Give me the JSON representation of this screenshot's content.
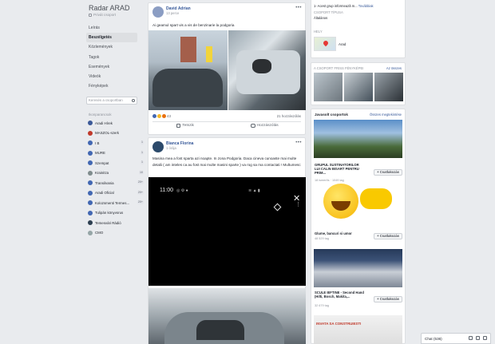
{
  "sidebar": {
    "group_title": "Radar ARAD",
    "group_privacy": "Privát csoport",
    "nav": [
      "Leírás",
      "Beszélgetés",
      "Közlemények",
      "Tagok",
      "Események",
      "Videók",
      "Fényképek"
    ],
    "active_index": 1,
    "search_placeholder": "Keresés a csoportban",
    "shortcuts_heading": "Ikonparancsok",
    "shortcuts": [
      {
        "label": "Aradi Hírek",
        "count": ""
      },
      {
        "label": "MASZOL-szerk",
        "count": ""
      },
      {
        "label": "I B",
        "count": "1"
      },
      {
        "label": "MURE",
        "count": "1"
      },
      {
        "label": "Szempat",
        "count": "1"
      },
      {
        "label": "Krainitza",
        "count": "10"
      },
      {
        "label": "Transilvania",
        "count": "20+"
      },
      {
        "label": "Aradi Oficial",
        "count": "20+"
      },
      {
        "label": "Kolozsmenti Termes...",
        "count": "20+"
      },
      {
        "label": "Tulipán könyvsrus",
        "count": ""
      },
      {
        "label": "Temesvári Rádió",
        "count": ""
      },
      {
        "label": "CMO",
        "count": ""
      }
    ]
  },
  "posts": [
    {
      "author": "David Adrian",
      "time": "13 perce",
      "text": "Ai geamul spart vis a vis de benzinarie la podgoria",
      "reactions_count": "43",
      "comments_count": "21 hozzászólás",
      "like_label": "Tetszik",
      "comment_label": "Hozzászólás"
    },
    {
      "author": "Bianca Florina",
      "time": "1 órája",
      "text": "Masina mea a fost sparta azi noapte. In zona Podgoria. Daca cineva cunoaste mai multe detalii ( am inteles ca au fost mai multe masini sparte ) va rog sa ma contactati ! Multumesc",
      "video_time": "11:00"
    }
  ],
  "right": {
    "about_line1": "1- Acest grup informează m...",
    "about_more": "Továbbiak",
    "type_heading": "CSOPORT TÍPUSA",
    "type_value": "Általános",
    "location_heading": "HELY",
    "location_value": "Arad",
    "files_heading": "A CSOPORT FRISS FÉNYKÉPEI",
    "files_see_all": "Az összes",
    "suggest_heading": "Javasolt csoportok",
    "suggest_see_all": "Összes megtekintése",
    "join_label": "+ Csatlakozás",
    "suggestions": [
      {
        "name": "GRUPUL SUSTINATORILOR LUI CALIN BISART PENTRU PRIM...",
        "meta": "18 ismerős · 1049 tag"
      },
      {
        "name": "Glume, bancuri si umor",
        "meta": "48 529 tag"
      },
      {
        "name": "SCULE IEFTINE - Second Hand (Hilti, Bosch, Makita,...",
        "meta": "32 679 tag"
      },
      {
        "name": "INVATA SA CONSTRUIESTI",
        "meta": ""
      }
    ]
  },
  "chat": {
    "label": "Chat (536)"
  },
  "colors": {
    "link": "#365899",
    "bg": "#e9ebee",
    "brand": "#4267b2"
  }
}
